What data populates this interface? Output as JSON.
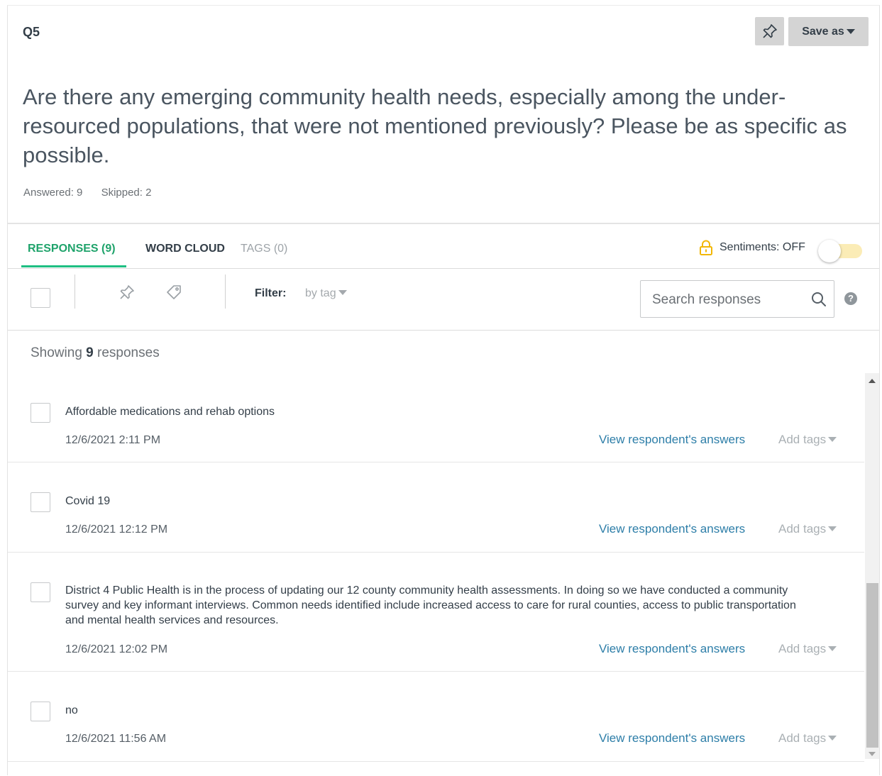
{
  "question": {
    "number": "Q5",
    "text": "Are there any emerging community health needs, especially among the under-resourced populations, that were not mentioned previously? Please be as specific as possible.",
    "answered": "Answered: 9",
    "skipped": "Skipped: 2"
  },
  "header": {
    "pin_icon": "pin-icon",
    "save_as_label": "Save as"
  },
  "tabs": [
    {
      "label": "RESPONSES (9)",
      "active": true
    },
    {
      "label": "WORD CLOUD",
      "active": false
    },
    {
      "label": "TAGS (0)",
      "active": false
    }
  ],
  "sentiments": {
    "label": "Sentiments: OFF",
    "state": "off",
    "lock_icon": "lock-icon"
  },
  "toolbar": {
    "filter_label": "Filter:",
    "filter_value": "by tag",
    "search_placeholder": "Search responses",
    "help_label": "?"
  },
  "showing": {
    "prefix": "Showing",
    "count": "9",
    "suffix": "responses"
  },
  "responses": [
    {
      "text": "Affordable medications and rehab options",
      "date": "12/6/2021 2:11 PM",
      "view_label": "View respondent's answers",
      "tags_label": "Add tags"
    },
    {
      "text": "Covid 19",
      "date": "12/6/2021 12:12 PM",
      "view_label": "View respondent's answers",
      "tags_label": "Add tags"
    },
    {
      "text": "District 4 Public Health is in the process of updating our 12 county community health assessments. In doing so we have conducted a community survey and key informant interviews. Common needs identified include increased access to care for rural counties, access to public transportation and mental health services and resources.",
      "date": "12/6/2021 12:02 PM",
      "view_label": "View respondent's answers",
      "tags_label": "Add tags"
    },
    {
      "text": "no",
      "date": "12/6/2021 11:56 AM",
      "view_label": "View respondent's answers",
      "tags_label": "Add tags"
    }
  ],
  "colors": {
    "accent_green": "#1fa36b",
    "link_blue": "#2d7ea8",
    "toggle_off": "#fbecb6",
    "lock_amber": "#f2b705"
  }
}
